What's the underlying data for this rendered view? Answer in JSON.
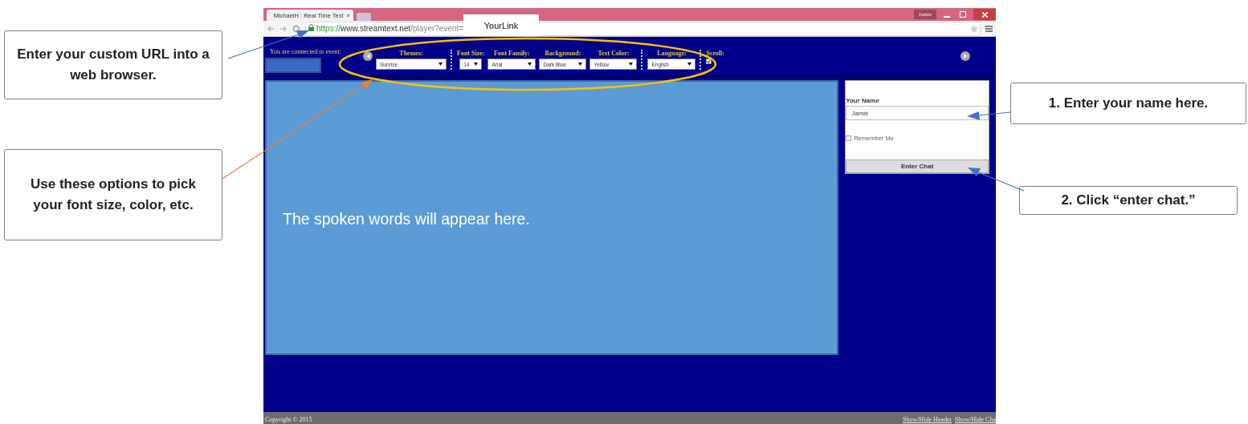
{
  "callouts_left": [
    {
      "text": "Enter your custom URL into a web browser."
    },
    {
      "text": "Use these options to pick your font size, color, etc."
    }
  ],
  "callouts_right": [
    {
      "text": "1. Enter your name here."
    },
    {
      "text": "2. Click “enter chat.”"
    }
  ],
  "browser": {
    "tab_title": "MichaelH : Real Time Text",
    "tab_close": "×",
    "profile": "Jamie",
    "url_scheme": "https://",
    "url_host": "www.streamtext.net",
    "url_path": "/player?event=",
    "link_overlay": "YourLink"
  },
  "player": {
    "connected_label": "You are connected to event:",
    "controls": [
      {
        "kind": "select",
        "label": "Themes:",
        "value": "Sunrise",
        "separator": true
      },
      {
        "kind": "select",
        "label": "Font Size:",
        "value": "14",
        "separator": false
      },
      {
        "kind": "select",
        "label": "Font Family:",
        "value": "Arial",
        "separator": false
      },
      {
        "kind": "select",
        "label": "Background:",
        "value": "Dark Blue",
        "separator": false
      },
      {
        "kind": "select",
        "label": "Text Color:",
        "value": "Yellow",
        "separator": true
      },
      {
        "kind": "select",
        "label": "Language:",
        "value": "English",
        "separator": true
      },
      {
        "kind": "checkbox",
        "label": "Scroll:",
        "checked": true
      }
    ],
    "caption_text": "The spoken words will appear here.",
    "login": {
      "name_label": "Your Name",
      "name_value": "Jamie",
      "remember_label": "Remember Me",
      "remember_checked": false,
      "button": "Enter Chat"
    },
    "footer": {
      "copyright": "Copyright © 2015",
      "links": [
        "Show/Hide Header",
        "Show/Hide Cha"
      ]
    }
  }
}
